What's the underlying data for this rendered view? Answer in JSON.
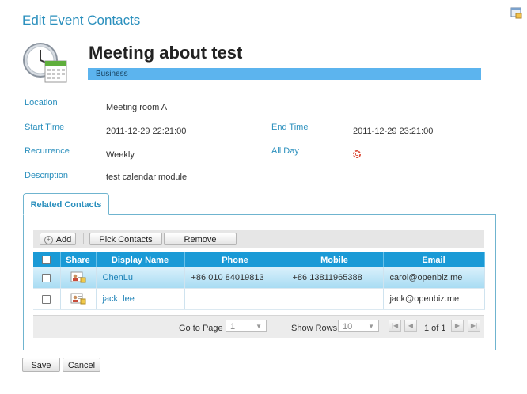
{
  "page": {
    "title": "Edit Event Contacts"
  },
  "event": {
    "title": "Meeting about test",
    "category": "Business",
    "location_label": "Location",
    "location": "Meeting room A",
    "start_label": "Start Time",
    "start": "2011-12-29 22:21:00",
    "end_label": "End Time",
    "end": "2011-12-29 23:21:00",
    "recurrence_label": "Recurrence",
    "recurrence": "Weekly",
    "allday_label": "All Day",
    "description_label": "Description",
    "description": "test calendar module"
  },
  "tabs": {
    "related_contacts": "Related Contacts"
  },
  "toolbar": {
    "add": "Add",
    "pick": "Pick Contacts",
    "remove": "Remove"
  },
  "grid": {
    "columns": [
      "Share",
      "Display Name",
      "Phone",
      "Mobile",
      "Email"
    ],
    "rows": [
      {
        "name": "ChenLu",
        "phone": "+86 010 84019813",
        "mobile": "+86 13811965388",
        "email": "carol@openbiz.me"
      },
      {
        "name": "jack, lee",
        "phone": "",
        "mobile": "",
        "email": "jack@openbiz.me"
      }
    ]
  },
  "pager": {
    "goto_label": "Go to Page",
    "page": "1",
    "rows_label": "Show Rows",
    "rows": "10",
    "of_text": "1 of 1"
  },
  "footer": {
    "save": "Save",
    "cancel": "Cancel"
  }
}
